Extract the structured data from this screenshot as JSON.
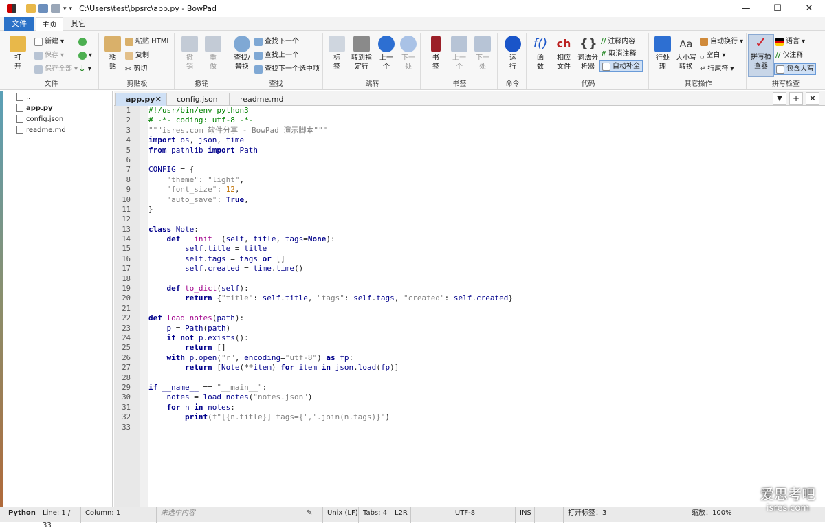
{
  "window": {
    "title": "C:\\Users\\test\\bpsrc\\app.py - BowPad",
    "minimize": "—",
    "maximize": "☐",
    "close": "✕"
  },
  "ribbon_tabs": {
    "file": "文件",
    "home": "主页",
    "other": "其它"
  },
  "ribbon": {
    "file": {
      "label": "文件",
      "open": "打\n开",
      "new": "新建",
      "save": "保存",
      "save_all": "保存全部"
    },
    "clipboard": {
      "label": "剪贴板",
      "paste": "粘\n贴",
      "paste_html": "粘贴 HTML",
      "copy": "复制",
      "cut": "剪切"
    },
    "undo": {
      "label": "撤销",
      "undo": "撤\n销",
      "redo": "重\n做"
    },
    "find": {
      "label": "查找",
      "find_replace": "查找/\n替换",
      "find_next": "查找下一个",
      "find_prev": "查找上一个",
      "find_next_sel": "查找下一个选中项"
    },
    "goto": {
      "label": "跳转",
      "tags": "标\n签",
      "goto_line": "转到指\n定行",
      "prev": "上一\n个",
      "next": "下一\n处"
    },
    "bookmark": {
      "label": "书签",
      "bookmark": "书\n签",
      "prev": "上一\n个",
      "next": "下一\n处"
    },
    "command": {
      "label": "命令",
      "run": "运\n行"
    },
    "code": {
      "label": "代码",
      "func": "函\n数",
      "related": "相应\n文件",
      "lexer": "词法分\n析器",
      "comment": "注释内容",
      "uncomment": "取消注释",
      "autocomplete": "自动补全"
    },
    "other_ops": {
      "label": "其它操作",
      "line_ops": "行处\n理",
      "case": "大小写\n转换",
      "autowrap": "自动换行",
      "whitespace": "空白",
      "line_end": "行尾符"
    },
    "spell": {
      "label": "拼写检查",
      "checker": "拼写检\n查器",
      "language": "语言",
      "comments_only": "仅注释",
      "include_caps": "包含大写"
    }
  },
  "sidebar": {
    "items": [
      "..",
      "app.py",
      "config.json",
      "readme.md"
    ]
  },
  "doc_tabs": [
    {
      "label": "app.py"
    },
    {
      "label": "config.json"
    },
    {
      "label": "readme.md"
    }
  ],
  "doc_tab_buttons": {
    "dropdown": "▼",
    "add": "+",
    "close": "✕"
  },
  "code_lines": [
    "#!/usr/bin/env python3",
    "# -*- coding: utf-8 -*-",
    "\"\"\"isres.com 软件分享 - BowPad 演示脚本\"\"\"",
    "import os, json, time",
    "from pathlib import Path",
    "",
    "CONFIG = {",
    "    \"theme\": \"light\",",
    "    \"font_size\": 12,",
    "    \"auto_save\": True,",
    "}",
    "",
    "class Note:",
    "    def __init__(self, title, tags=None):",
    "        self.title = title",
    "        self.tags = tags or []",
    "        self.created = time.time()",
    "",
    "    def to_dict(self):",
    "        return {\"title\": self.title, \"tags\": self.tags, \"created\": self.created}",
    "",
    "def load_notes(path):",
    "    p = Path(path)",
    "    if not p.exists():",
    "        return []",
    "    with p.open(\"r\", encoding=\"utf-8\") as fp:",
    "        return [Note(**item) for item in json.load(fp)]",
    "",
    "if __name__ == \"__main__\":",
    "    notes = load_notes(\"notes.json\")",
    "    for n in notes:",
    "        print(f\"[{n.title}] tags={','.join(n.tags)}\")",
    ""
  ],
  "status": {
    "lexer": "Python",
    "line": "Line: 1 / 33",
    "column": "Column: 1",
    "selection": "未选中内容",
    "eol": "Unix (LF)",
    "tabs": "Tabs: 4",
    "dir": "L2R",
    "encoding": "UTF-8",
    "ins": "INS",
    "open_tabs": "打开标签：3",
    "zoom": "缩放：100%"
  },
  "watermark": {
    "cn": "爱思考吧",
    "en": "isres.com"
  },
  "colors": {
    "accent": "#2b72c8",
    "active_tab": "#cfe0f5",
    "keyword": "#00008b",
    "string": "#808080",
    "comment": "#008000",
    "number": "#c07000",
    "function": "#a0008b"
  }
}
